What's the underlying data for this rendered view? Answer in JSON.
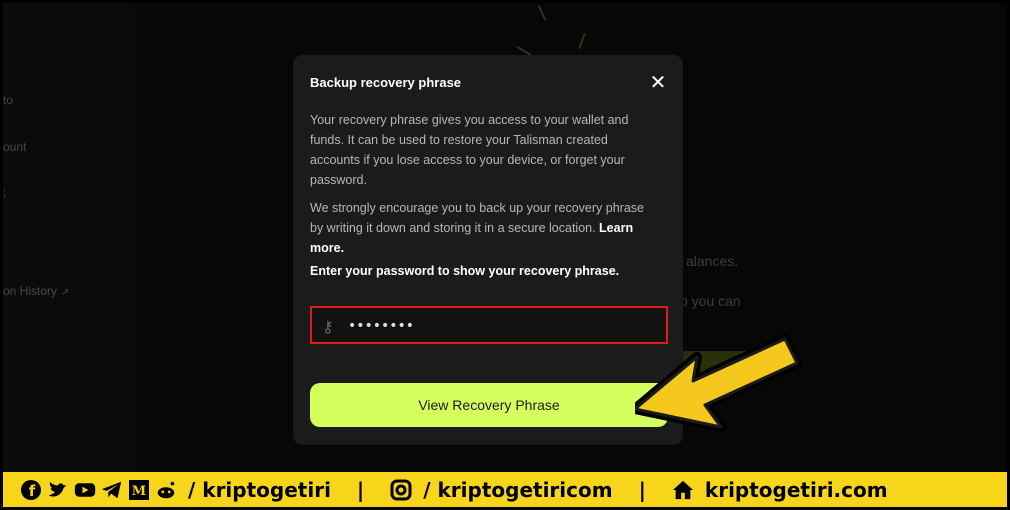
{
  "sidebar": {
    "items": [
      {
        "label": "to"
      },
      {
        "label": "ount"
      },
      {
        "label": ";"
      },
      {
        "label": "on History"
      }
    ]
  },
  "background": {
    "line1": "alances.",
    "line2": "o you can"
  },
  "modal": {
    "title": "Backup recovery phrase",
    "para1": "Your recovery phrase gives you access to your wallet and funds. It can be used to restore your Talisman created accounts if you lose access to your device, or forget your password.",
    "para2_text": "We strongly encourage you to back up your recovery phrase by writing it down and storing it in a secure location. ",
    "para2_link": "Learn more.",
    "prompt": "Enter your password to show your recovery phrase.",
    "password_value": "••••••••",
    "button_label": "View Recovery Phrase"
  },
  "footer": {
    "handle1": "/ kriptogetiri",
    "separator": "|",
    "handle2": "/ kriptogetiricom",
    "handle3": "kriptogetiri.com"
  },
  "colors": {
    "accent": "#d5ff5c",
    "highlight_border": "#e11a1a",
    "footer_bg": "#f7d51a",
    "arrow": "#f4c81c"
  }
}
